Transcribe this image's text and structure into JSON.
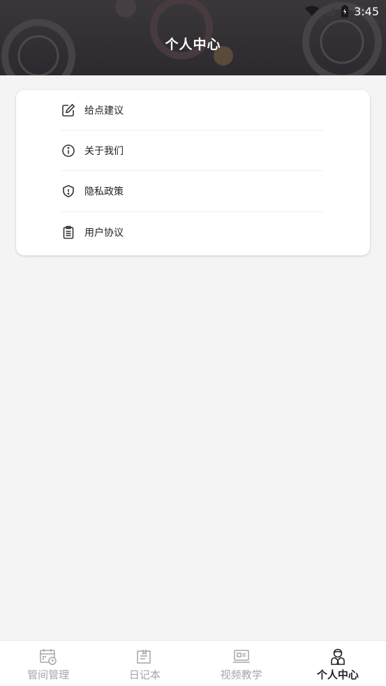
{
  "status_bar": {
    "time": "3:45",
    "icons": [
      "wifi-icon",
      "signal-icon",
      "battery-icon"
    ]
  },
  "header": {
    "title": "个人中心"
  },
  "menu": {
    "items": [
      {
        "label": "给点建议",
        "icon": "edit-icon"
      },
      {
        "label": "关于我们",
        "icon": "info-icon"
      },
      {
        "label": "隐私政策",
        "icon": "shield-icon"
      },
      {
        "label": "用户协议",
        "icon": "clipboard-icon"
      }
    ]
  },
  "tabbar": {
    "active": 3,
    "tabs": [
      {
        "label": "管间管理",
        "icon": "calendar-clock-icon"
      },
      {
        "label": "日记本",
        "icon": "notebook-icon"
      },
      {
        "label": "视频教学",
        "icon": "monitor-icon"
      },
      {
        "label": "个人中心",
        "icon": "person-icon"
      }
    ]
  },
  "colors": {
    "header_bg": "#2f2c30",
    "page_bg": "#f4f4f4",
    "active_tab": "#222222",
    "inactive_tab": "#a6a6a6"
  }
}
